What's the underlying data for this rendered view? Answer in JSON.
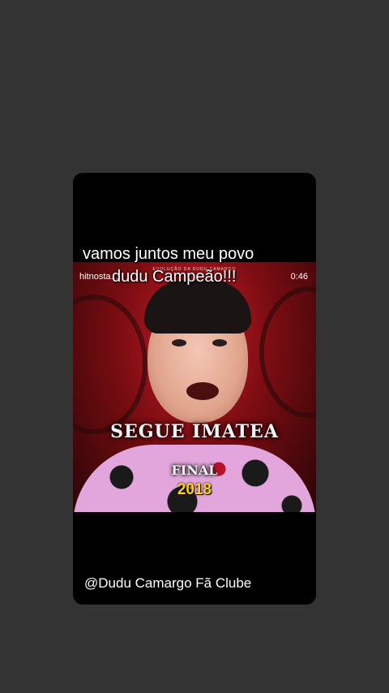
{
  "post": {
    "caption_line1": "vamos juntos meu povo",
    "caption_line2": "dudu Campeão!!!",
    "credit": "@Dudu Camargo Fã Clube"
  },
  "video": {
    "channel": "hitnosta...",
    "duration": "0:46",
    "top_overlay": "EVOLUÇÃO DA DUDU CAMARGO",
    "segue_text": "SEGUE IMATEA",
    "final_text": "FINAL",
    "year": "2018"
  },
  "colors": {
    "page_background": "#333333",
    "card_background": "#000000",
    "year_text": "#ffd21a",
    "video_red": "#c21c24"
  }
}
